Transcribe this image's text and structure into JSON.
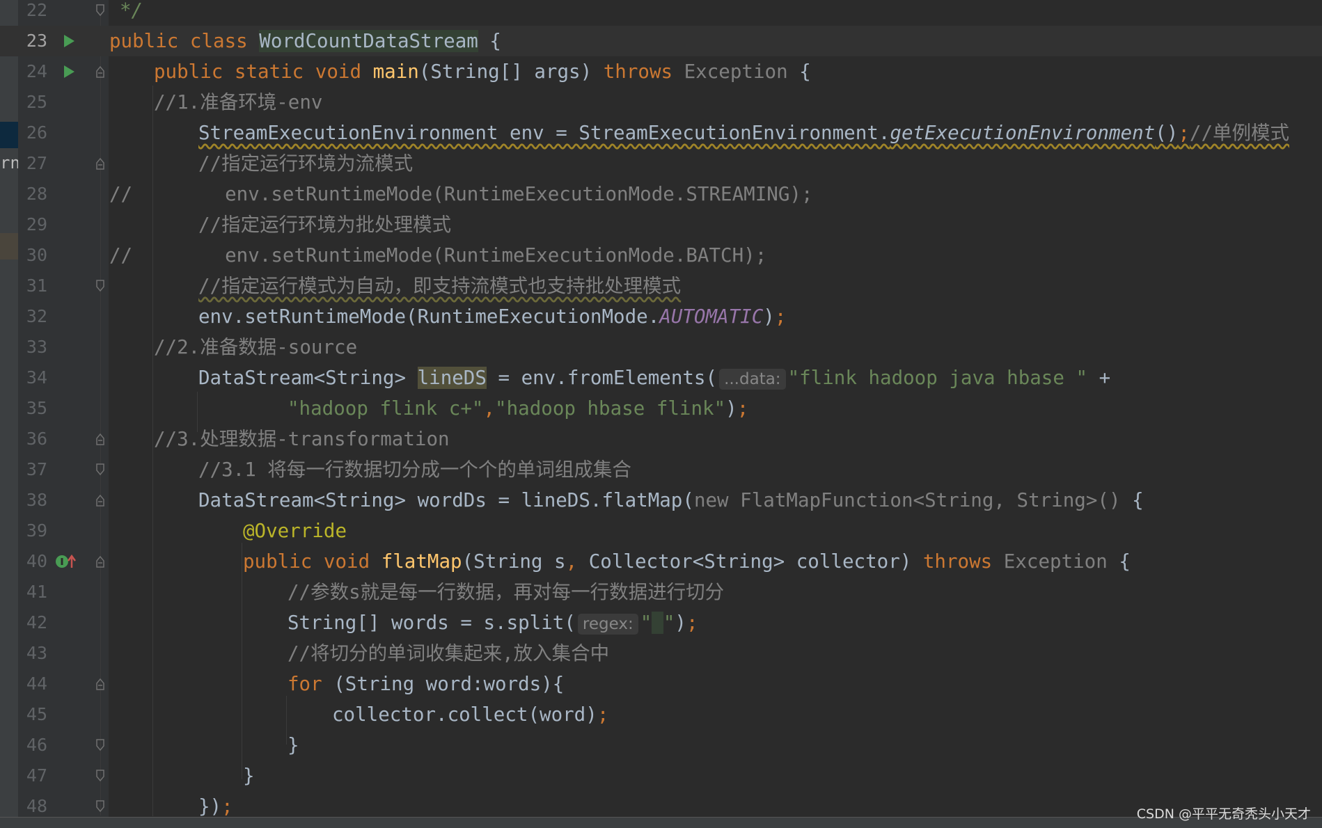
{
  "editor": {
    "lines": [
      {
        "num": "22"
      },
      {
        "num": "23"
      },
      {
        "num": "24"
      },
      {
        "num": "25"
      },
      {
        "num": "26"
      },
      {
        "num": "27"
      },
      {
        "num": "28"
      },
      {
        "num": "29"
      },
      {
        "num": "30"
      },
      {
        "num": "31"
      },
      {
        "num": "32"
      },
      {
        "num": "33"
      },
      {
        "num": "34"
      },
      {
        "num": "35"
      },
      {
        "num": "36"
      },
      {
        "num": "37"
      },
      {
        "num": "38"
      },
      {
        "num": "39"
      },
      {
        "num": "40"
      },
      {
        "num": "41"
      },
      {
        "num": "42"
      },
      {
        "num": "43"
      },
      {
        "num": "44"
      },
      {
        "num": "45"
      },
      {
        "num": "46"
      },
      {
        "num": "47"
      },
      {
        "num": "48"
      }
    ],
    "current_line": "23",
    "text": {
      "l22_comment": "*/",
      "l23_public": "public",
      "l23_class": "class",
      "l23_name": "WordCountDataStream",
      "l23_brace": " {",
      "l24_mods": "public static void",
      "l24_main": "main",
      "l24_params": "(String[] args) ",
      "l24_throws": "throws",
      "l24_exc": "Exception",
      "l24_brace": " {",
      "l25": "//1.准备环境-env",
      "l26_decl": "StreamExecutionEnvironment env = StreamExecutionEnvironment.",
      "l26_method": "getExecutionEnvironment",
      "l26_paren": "()",
      "l26_semi": ";",
      "l26_comment": "//单例模式",
      "l27": "//指定运行环境为流模式",
      "l28_slashes": "//",
      "l28_code": "env.setRuntimeMode(RuntimeExecutionMode.STREAMING);",
      "l29": "//指定运行环境为批处理模式",
      "l30_slashes": "//",
      "l30_code": "env.setRuntimeMode(RuntimeExecutionMode.BATCH);",
      "l31": "//指定运行模式为自动，即支持流模式也支持批处理模式",
      "l32_code": "env.setRuntimeMode(RuntimeExecutionMode.",
      "l32_const": "AUTOMATIC",
      "l32_close": ")",
      "l32_semi": ";",
      "l33": "//2.准备数据-source",
      "l34_type": "DataStream<String> ",
      "l34_var": "lineDS",
      "l34_assign": " = env.fromElements(",
      "l34_hint": "...data:",
      "l34_str": "\"flink hadoop java hbase \"",
      "l34_plus": " +",
      "l35_str1": "\"hadoop flink c+\"",
      "l35_comma": ",",
      "l35_str2": "\"hadoop hbase flink\"",
      "l35_close": ")",
      "l35_semi": ";",
      "l36": "//3.处理数据-transformation",
      "l37": "//3.1 将每一行数据切分成一个个的单词组成集合",
      "l38_code": "DataStream<String> wordDs = lineDS.flatMap(",
      "l38_anon": "new FlatMapFunction<String, String>()",
      "l38_brace": " {",
      "l39": "@Override",
      "l40_mods": "public void",
      "l40_fn": "flatMap",
      "l40_p1": "(String s",
      "l40_comma": ",",
      "l40_p2": " Collector<String> collector) ",
      "l40_throws": "throws",
      "l40_exc": "Exception",
      "l40_brace": " {",
      "l41": "//参数s就是每一行数据，再对每一行数据进行切分",
      "l42_code": "String[] words = s.split(",
      "l42_hint": "regex:",
      "l42_q1": "\"",
      "l42_space": " ",
      "l42_q2": "\"",
      "l42_close": ")",
      "l42_semi": ";",
      "l43": "//将切分的单词收集起来,放入集合中",
      "l44_for": "for",
      "l44_rest": " (String word:words){",
      "l45_code": "collector.collect(word)",
      "l45_semi": ";",
      "l46": "}",
      "l47": "}",
      "l48_close": "})",
      "l48_semi": ";"
    }
  },
  "left_strip_label": "rn",
  "watermark": "CSDN @平平无奇秃头小天才",
  "colors": {
    "background": "#2b2b2b",
    "keyword": "#cc7832",
    "string": "#6a8759",
    "comment": "#808080",
    "method": "#ffc66d",
    "annotation": "#bbb529",
    "constant": "#9876aa",
    "run_icon": "#499c54"
  }
}
